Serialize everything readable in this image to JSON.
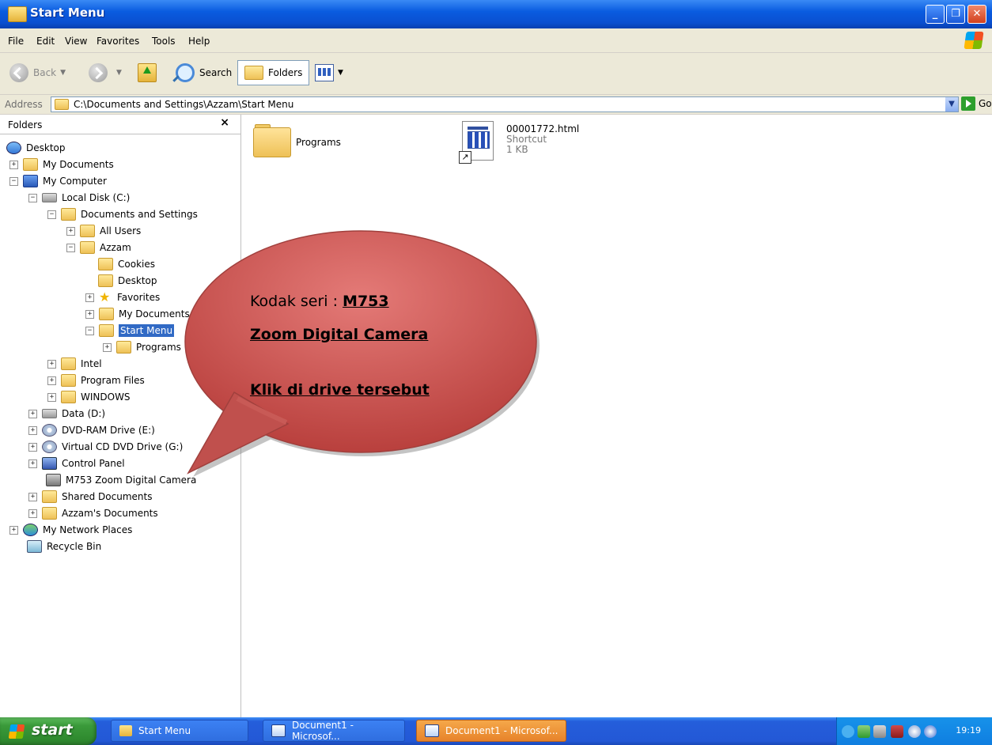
{
  "window": {
    "title": "Start Menu",
    "min": "_",
    "max": "❐",
    "close": "✕"
  },
  "menu": [
    "File",
    "Edit",
    "View",
    "Favorites",
    "Tools",
    "Help"
  ],
  "toolbar": {
    "back": "Back",
    "search": "Search",
    "folders": "Folders"
  },
  "address": {
    "label": "Address",
    "value": "C:\\Documents and Settings\\Azzam\\Start Menu",
    "go": "Go"
  },
  "folders_pane": {
    "title": "Folders",
    "close": "×",
    "items": [
      {
        "label": "Desktop"
      },
      {
        "label": "My Documents",
        "pm": "+"
      },
      {
        "label": "My Computer",
        "pm": "−"
      },
      {
        "label": "Local Disk (C:)",
        "pm": "−"
      },
      {
        "label": "Documents and Settings",
        "pm": "−"
      },
      {
        "label": "All Users",
        "pm": "+"
      },
      {
        "label": "Azzam",
        "pm": "−"
      },
      {
        "label": "Cookies"
      },
      {
        "label": "Desktop"
      },
      {
        "label": "Favorites",
        "pm": "+"
      },
      {
        "label": "My Documents",
        "pm": "+"
      },
      {
        "label": "Start Menu",
        "pm": "−"
      },
      {
        "label": "Programs",
        "pm": "+"
      },
      {
        "label": "Intel",
        "pm": "+"
      },
      {
        "label": "Program Files",
        "pm": "+"
      },
      {
        "label": "WINDOWS",
        "pm": "+"
      },
      {
        "label": "Data (D:)",
        "pm": "+"
      },
      {
        "label": "DVD-RAM Drive (E:)",
        "pm": "+"
      },
      {
        "label": "Virtual CD DVD Drive (G:)",
        "pm": "+"
      },
      {
        "label": "Control Panel",
        "pm": "+"
      },
      {
        "label": "M753 Zoom Digital Camera"
      },
      {
        "label": "Shared Documents",
        "pm": "+"
      },
      {
        "label": "Azzam's Documents",
        "pm": "+"
      },
      {
        "label": "My Network Places",
        "pm": "+"
      },
      {
        "label": "Recycle Bin"
      }
    ]
  },
  "content": {
    "folder": "Programs",
    "shortcut": {
      "name": "00001772.html",
      "type": "Shortcut",
      "size": "1 KB"
    }
  },
  "callout": {
    "line1_prefix": "Kodak seri : ",
    "line1_bold": "M753",
    "line2": "Zoom Digital Camera",
    "line3": "Klik di drive tersebut",
    "fill": "#c0504d"
  },
  "taskbar": {
    "start": "start",
    "buttons": [
      "Start Menu",
      "Document1 - Microsof...",
      "Document1 - Microsof..."
    ],
    "clock": "19:19"
  }
}
